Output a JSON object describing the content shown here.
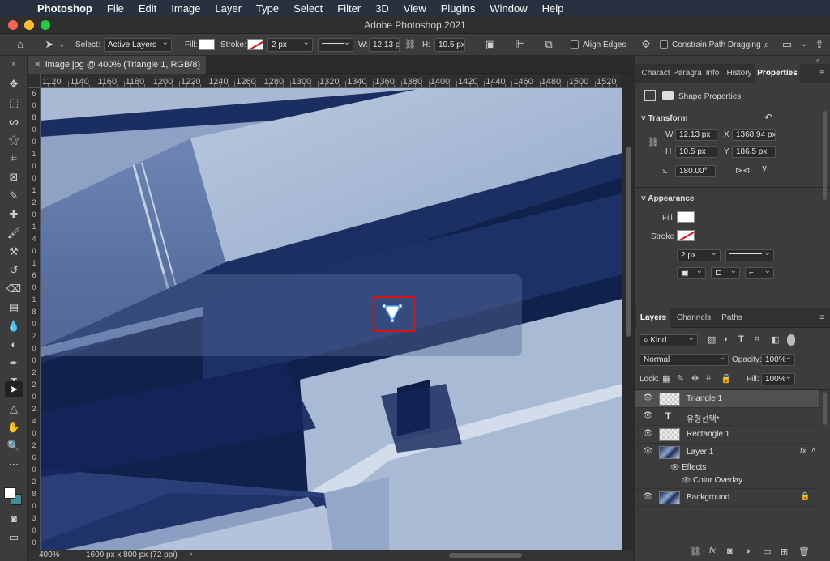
{
  "menubar": {
    "items": [
      "Photoshop",
      "File",
      "Edit",
      "Image",
      "Layer",
      "Type",
      "Select",
      "Filter",
      "3D",
      "View",
      "Plugins",
      "Window",
      "Help"
    ]
  },
  "window": {
    "title": "Adobe Photoshop 2021"
  },
  "options": {
    "select_label": "Select:",
    "select_value": "Active Layers",
    "fill_label": "Fill:",
    "stroke_label": "Stroke:",
    "stroke_width": "2 px",
    "w_label": "W:",
    "w_value": "12.13 px",
    "h_label": "H:",
    "h_value": "10.5 px",
    "align_edges": "Align Edges",
    "constrain": "Constrain Path Dragging"
  },
  "document": {
    "tab_title": "image.jpg @ 400% (Triangle 1, RGB/8) *",
    "zoom": "400%",
    "size_info": "1600 px x 800 px (72 ppi)"
  },
  "ruler": {
    "h_labels": [
      "1120",
      "1140",
      "1160",
      "1180",
      "1200",
      "1220",
      "1240",
      "1260",
      "1280",
      "1300",
      "1320",
      "1340",
      "1360",
      "1380",
      "1400",
      "1420",
      "1440",
      "1460",
      "1480",
      "1500",
      "1520"
    ],
    "v_labels": [
      "6",
      "0",
      "8",
      "0",
      "0",
      "1",
      "0",
      "0",
      "1",
      "2",
      "0",
      "1",
      "4",
      "0",
      "1",
      "6",
      "0",
      "1",
      "8",
      "0",
      "2",
      "0",
      "0",
      "2",
      "2",
      "0",
      "2",
      "4",
      "0",
      "2",
      "6",
      "0",
      "2",
      "8",
      "0",
      "3",
      "0",
      "0"
    ]
  },
  "panel_tabs": {
    "items": [
      "Charact",
      "Paragra",
      "Info",
      "History",
      "Properties"
    ],
    "active": "Properties"
  },
  "properties": {
    "shape_props": "Shape Properties",
    "transform_title": "Transform",
    "w_label": "W",
    "w_value": "12.13 px",
    "x_label": "X",
    "x_value": "1368.94 px",
    "h_label": "H",
    "h_value": "10.5 px",
    "y_label": "Y",
    "y_value": "186.5 px",
    "angle": "180.00°",
    "appearance_title": "Appearance",
    "fill_label": "Fill",
    "stroke_label": "Stroke",
    "stroke_width": "2 px"
  },
  "layers_panel": {
    "tabs": [
      "Layers",
      "Channels",
      "Paths"
    ],
    "kind": "Kind",
    "blend_mode": "Normal",
    "opacity_label": "Opacity:",
    "opacity_value": "100%",
    "lock_label": "Lock:",
    "fill_label": "Fill:",
    "fill_value": "100%",
    "layers": [
      {
        "name": "Triangle 1"
      },
      {
        "name": "유형선택*"
      },
      {
        "name": "Rectangle 1"
      },
      {
        "name": "Layer 1"
      },
      {
        "name": "Effects"
      },
      {
        "name": "Color Overlay"
      },
      {
        "name": "Background"
      }
    ]
  },
  "colors": {
    "accent_red": "#e01010",
    "canvas_dark": "#10214b",
    "canvas_light": "#a8bbd6"
  }
}
